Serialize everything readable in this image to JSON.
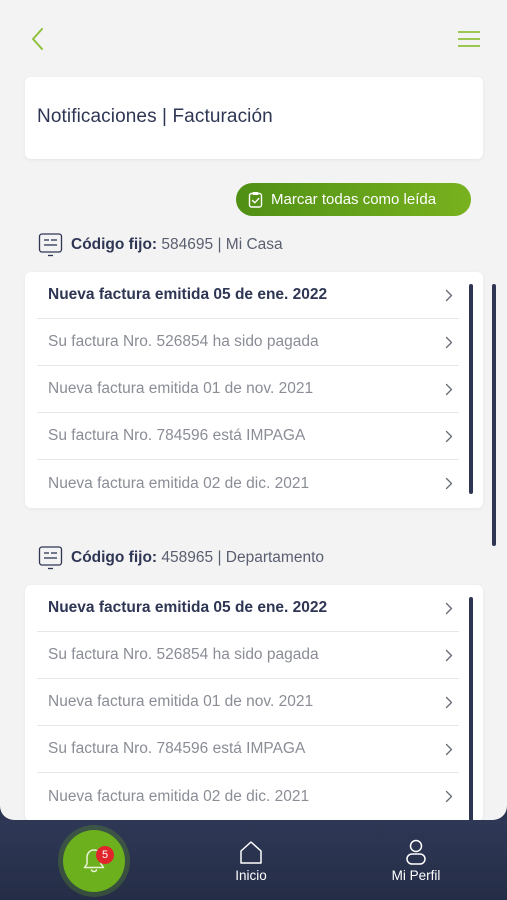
{
  "header": {
    "title": "Notificaciones | Facturación"
  },
  "actions": {
    "mark_all_label": "Marcar todas como leída"
  },
  "accounts": [
    {
      "label": "Código fijo:",
      "code": "584695",
      "name": "| Mi Casa",
      "notifications": [
        {
          "text": "Nueva factura emitida 05 de ene. 2022",
          "unread": true
        },
        {
          "text": "Su factura Nro. 526854 ha sido pagada",
          "unread": false
        },
        {
          "text": "Nueva factura emitida 01 de nov. 2021",
          "unread": false
        },
        {
          "text": "Su factura Nro. 784596 está IMPAGA",
          "unread": false
        },
        {
          "text": "Nueva factura emitida 02 de dic. 2021",
          "unread": false
        }
      ]
    },
    {
      "label": "Código fijo:",
      "code": "458965",
      "name": "| Departamento",
      "notifications": [
        {
          "text": "Nueva factura emitida 05 de ene. 2022",
          "unread": true
        },
        {
          "text": "Su factura Nro. 526854 ha sido pagada",
          "unread": false
        },
        {
          "text": "Nueva factura emitida 01 de nov. 2021",
          "unread": false
        },
        {
          "text": "Su factura Nro. 784596 está IMPAGA",
          "unread": false
        },
        {
          "text": "Nueva factura emitida 02 de dic. 2021",
          "unread": false
        }
      ]
    }
  ],
  "bottom_nav": {
    "notifications_badge": "5",
    "home_label": "Inicio",
    "profile_label": "Mi Perfil"
  },
  "colors": {
    "accent_green": "#6cb01e",
    "navy": "#2e3654",
    "badge_red": "#e0262b"
  },
  "icons": {
    "back": "chevron-left-icon",
    "menu": "hamburger-menu-icon",
    "mark_all": "clipboard-check-icon",
    "account": "landline-phone-icon",
    "row": "chevron-right-icon",
    "notifications": "bell-icon",
    "home": "home-icon",
    "profile": "user-icon"
  }
}
